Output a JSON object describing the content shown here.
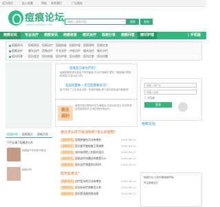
{
  "topbar": {
    "links": [
      "设为首页",
      "加入收藏",
      "帮助",
      "联系我们",
      "广告服务"
    ]
  },
  "logo": {
    "title": "痘痕论坛",
    "url": "www.scardbbs.com"
  },
  "search": {
    "placeholder": "请输入搜索内容",
    "button": "搜索",
    "button2": "发帖"
  },
  "nav": {
    "items": [
      "痘痕论坛",
      "专业治疗",
      "痘痕资讯",
      "疤痕修复",
      "痘坑治疗",
      "祛痘分享",
      "痘痕问答",
      "痘印护理"
    ],
    "mobile": "手机版"
  },
  "subnav": {
    "rows": [
      {
        "cat": "痘痕资讯",
        "links": [
          "痘痕原因",
          "痘痕治疗",
          "痘痕修复",
          "痘痕护理",
          "痘痕预防",
          "痘痕饮食"
        ]
      },
      {
        "cat": "痘痕治疗",
        "links": [
          "激光治疗",
          "药物治疗",
          "手术治疗",
          "中医治疗",
          "填充治疗",
          "微针治疗"
        ]
      },
      {
        "cat": "痘坑问答",
        "links": [
          "痘坑类型",
          "痘坑修复",
          "痘坑护理",
          "痘坑预防",
          "痘坑饮食",
          "痘坑问题"
        ]
      }
    ]
  },
  "featured": {
    "post1_title": "痘痕是怎样治疗的?",
    "post1_text": "痘痕是痤疮愈后遗留下来的痕迹,在治疗痘痕时,要先了解痘痕的类型和成因,才能对症下药。",
    "post2_title": "祛痘痘需要一次还是需要多次?",
    "post2_text": "痘子祛除了之后还会出现一些痘印痘痕,那么如何祛除痘印痘痕呢?",
    "badge_line1": "痘友",
    "badge_line2": "福利",
    "post3_text": "痘痕的形成是因为毛孔堵塞后,引起炎症反应,在皮肤真皮层造成损伤,形成凹陷性的痘坑。"
  },
  "news": {
    "section_title": "痘坑怎么样才能消除呢?怎么去痘痕?",
    "items": [
      {
        "tag": "[痘痕资讯]",
        "title": "痘痕修复的方法有哪些",
        "date": "2024-06-22"
      },
      {
        "tag": "[痘痕资讯]",
        "title": "痘坑能不能恢复正常皮肤",
        "date": "2024-06-22"
      },
      {
        "tag": "[痘痕资讯]",
        "title": "如何去除脸上的痘印痘坑",
        "date": "2024-06-22"
      },
      {
        "tag": "[痘痕资讯]",
        "title": "痘痕治疗的最佳时期是什么",
        "date": "2024-06-22"
      },
      {
        "tag": "[痘痕资讯]",
        "title": "痘坑治疗需要多长时间",
        "date": "2024-06-22"
      }
    ],
    "section2_title": "如何去痘坑?",
    "items2": [
      {
        "tag": "[痘痕资讯]",
        "title": "治疗痘坑的方法有哪些",
        "date": "2024-06-22"
      },
      {
        "tag": "[痘痕资讯]",
        "title": "痘坑的治疗效果怎么样",
        "date": "2024-06-22"
      },
      {
        "tag": "[痘痕资讯]",
        "title": "痘坑是否能彻底治愈",
        "date": "2024-06-22"
      }
    ]
  },
  "side_tabs": [
    "痘痕好转",
    "痘痕图片",
    "痘痕问答"
  ],
  "side_items": [
    "下巴长满了痘痕怎么办",
    "痘痕留下来还能不能治",
    "痘痕好转"
  ],
  "right": {
    "input1": "请输入用户名",
    "input2": "请输入密码",
    "remember": "记住我",
    "login": "登录",
    "section": "痘痕论坛"
  },
  "bottom_right": {
    "text1": "痘痕论坛,让您远离痘痕烦恼。",
    "text2": "专注痘痕治疗"
  }
}
